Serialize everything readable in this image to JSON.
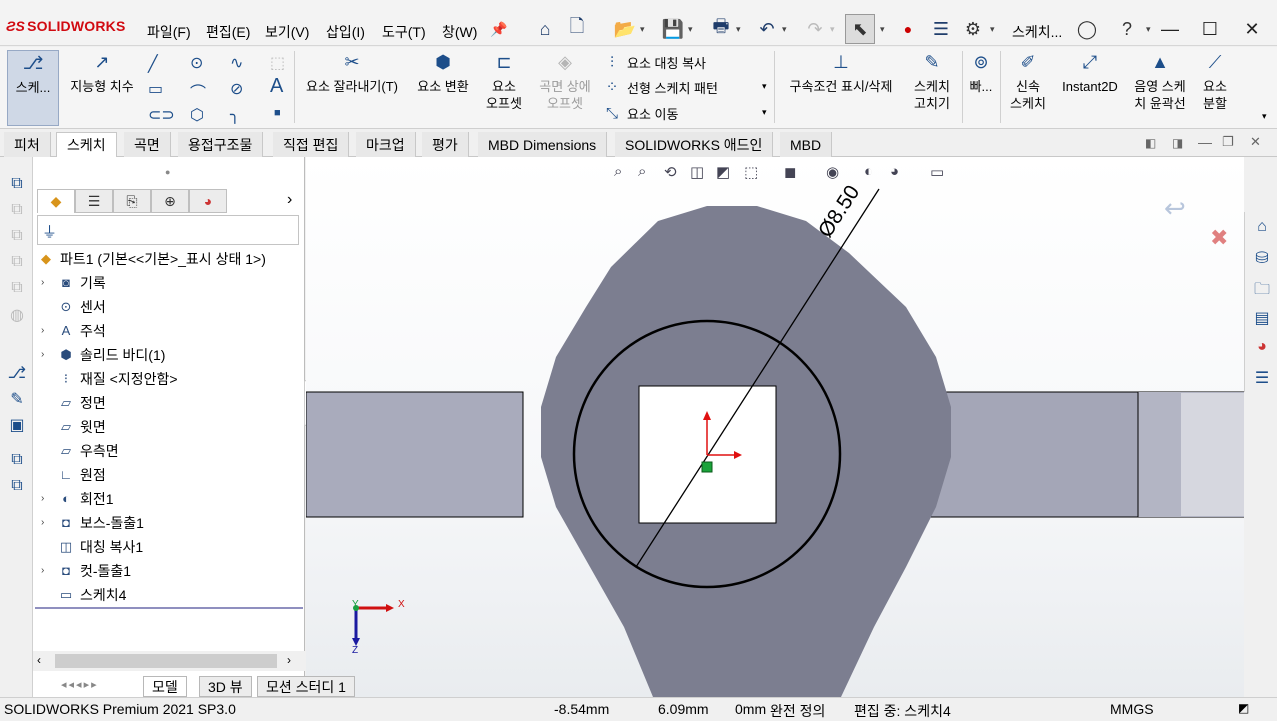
{
  "app": {
    "logo": "SOLIDWORKS",
    "menus": [
      "파일(F)",
      "편집(E)",
      "보기(V)",
      "삽입(I)",
      "도구(T)",
      "창(W)"
    ],
    "doc_label": "스케치..."
  },
  "ribbon": {
    "sketch": "스케...",
    "smart_dim": "지능형 치수",
    "trim": "요소 잘라내기(T)",
    "convert": "요소 변환",
    "offset_line1": "요소",
    "offset_line2": "오프셋",
    "surf_offset_line1": "곡면 상에",
    "surf_offset_line2": "오프셋",
    "mirror": "요소 대칭 복사",
    "linear_pattern": "선형 스케치 패턴",
    "move": "요소 이동",
    "relations": "구속조건 표시/삭제",
    "repair_line1": "스케치",
    "repair_line2": "고치기",
    "quick": "빠...",
    "rapid_line1": "신속",
    "rapid_line2": "스케치",
    "instant2d": "Instant2D",
    "shaded_line1": "음영 스케",
    "shaded_line2": "치 윤곽선",
    "split_line1": "요소",
    "split_line2": "분할"
  },
  "tabs": [
    "피처",
    "스케치",
    "곡면",
    "용접구조물",
    "직접 편집",
    "마크업",
    "평가",
    "MBD Dimensions",
    "SOLIDWORKS 애드인",
    "MBD"
  ],
  "tree": {
    "root": "파트1  (기본<<기본>_표시 상태 1>)",
    "items": [
      {
        "label": "기록",
        "expand": true
      },
      {
        "label": "센서",
        "expand": false
      },
      {
        "label": "주석",
        "expand": true
      },
      {
        "label": "솔리드 바디(1)",
        "expand": true
      },
      {
        "label": "재질 <지정안함>",
        "expand": false
      },
      {
        "label": "정면",
        "expand": false
      },
      {
        "label": "윗면",
        "expand": false
      },
      {
        "label": "우측면",
        "expand": false
      },
      {
        "label": "원점",
        "expand": false
      },
      {
        "label": "회전1",
        "expand": true
      },
      {
        "label": "보스-돌출1",
        "expand": true
      },
      {
        "label": "대칭 복사1",
        "expand": false
      },
      {
        "label": "컷-돌출1",
        "expand": true
      },
      {
        "label": "스케치4",
        "expand": false
      }
    ]
  },
  "bottom_tabs": [
    "모델",
    "3D 뷰",
    "모션 스터디 1"
  ],
  "status": {
    "product": "SOLIDWORKS Premium 2021 SP3.0",
    "x": "-8.54mm",
    "y": "6.09mm",
    "z": "0mm",
    "defined": "완전 정의",
    "editing": "편집 중: 스케치4",
    "units": "MMGS"
  },
  "viewport": {
    "dimension": "Ø8.50",
    "triad_x": "X",
    "triad_y": "Y",
    "triad_z": "Z"
  },
  "colors": {
    "part_fill": "#7c7e90",
    "arm_fill": "#a9abbc",
    "sketch_line": "#000000",
    "accent_red": "#d10a11"
  }
}
